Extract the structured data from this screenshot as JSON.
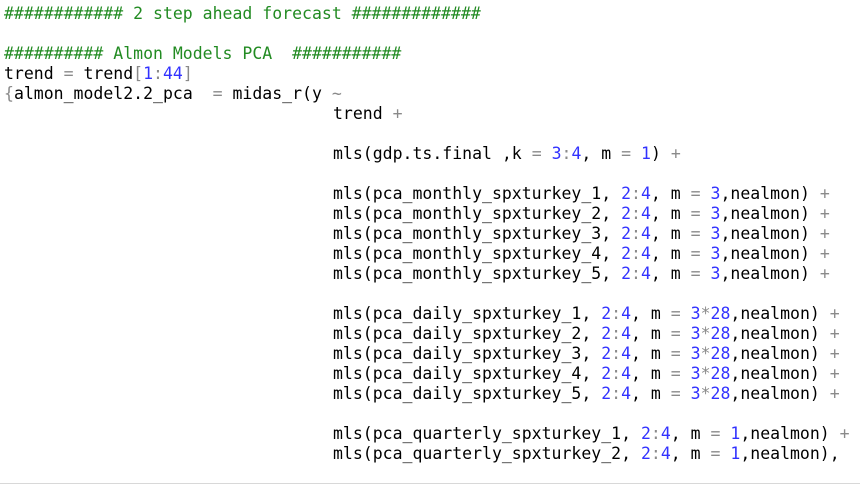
{
  "editor": {
    "colors": {
      "background": "#ffffff",
      "text": "#000000",
      "comment": "#228b22",
      "number": "#3232ff",
      "operator": "#8a8a8a"
    },
    "lines": [
      {
        "indent": 0,
        "tokens": [
          {
            "t": "############ 2 step ahead forecast #############",
            "c": "comment"
          }
        ]
      },
      {
        "indent": 0,
        "tokens": []
      },
      {
        "indent": 0,
        "tokens": [
          {
            "t": "########## Almon Models PCA  ###########",
            "c": "comment"
          }
        ]
      },
      {
        "indent": 0,
        "tokens": [
          {
            "t": "trend "
          },
          {
            "t": "=",
            "c": "op"
          },
          {
            "t": " trend"
          },
          {
            "t": "[",
            "c": "op"
          },
          {
            "t": "1",
            "c": "num"
          },
          {
            "t": ":",
            "c": "op"
          },
          {
            "t": "44",
            "c": "num"
          },
          {
            "t": "]",
            "c": "op"
          }
        ]
      },
      {
        "indent": 0,
        "tokens": [
          {
            "t": "{",
            "c": "op"
          },
          {
            "t": "almon_model2.2_pca  "
          },
          {
            "t": "=",
            "c": "op"
          },
          {
            "t": " midas_r(y "
          },
          {
            "t": "~",
            "c": "op"
          }
        ]
      },
      {
        "indent": 1,
        "tokens": [
          {
            "t": "trend "
          },
          {
            "t": "+",
            "c": "op"
          }
        ]
      },
      {
        "indent": 1,
        "tokens": []
      },
      {
        "indent": 1,
        "tokens": [
          {
            "t": "mls(gdp.ts.final ,k "
          },
          {
            "t": "=",
            "c": "op"
          },
          {
            "t": " "
          },
          {
            "t": "3",
            "c": "num"
          },
          {
            "t": ":",
            "c": "op"
          },
          {
            "t": "4",
            "c": "num"
          },
          {
            "t": ", m "
          },
          {
            "t": "=",
            "c": "op"
          },
          {
            "t": " "
          },
          {
            "t": "1",
            "c": "num"
          },
          {
            "t": ") "
          },
          {
            "t": "+",
            "c": "op"
          }
        ]
      },
      {
        "indent": 1,
        "tokens": []
      },
      {
        "indent": 1,
        "tokens": [
          {
            "t": "mls(pca_monthly_spxturkey_1, "
          },
          {
            "t": "2",
            "c": "num"
          },
          {
            "t": ":",
            "c": "op"
          },
          {
            "t": "4",
            "c": "num"
          },
          {
            "t": ", m "
          },
          {
            "t": "=",
            "c": "op"
          },
          {
            "t": " "
          },
          {
            "t": "3",
            "c": "num"
          },
          {
            "t": ",nealmon) "
          },
          {
            "t": "+",
            "c": "op"
          }
        ]
      },
      {
        "indent": 1,
        "tokens": [
          {
            "t": "mls(pca_monthly_spxturkey_2, "
          },
          {
            "t": "2",
            "c": "num"
          },
          {
            "t": ":",
            "c": "op"
          },
          {
            "t": "4",
            "c": "num"
          },
          {
            "t": ", m "
          },
          {
            "t": "=",
            "c": "op"
          },
          {
            "t": " "
          },
          {
            "t": "3",
            "c": "num"
          },
          {
            "t": ",nealmon) "
          },
          {
            "t": "+",
            "c": "op"
          }
        ]
      },
      {
        "indent": 1,
        "tokens": [
          {
            "t": "mls(pca_monthly_spxturkey_3, "
          },
          {
            "t": "2",
            "c": "num"
          },
          {
            "t": ":",
            "c": "op"
          },
          {
            "t": "4",
            "c": "num"
          },
          {
            "t": ", m "
          },
          {
            "t": "=",
            "c": "op"
          },
          {
            "t": " "
          },
          {
            "t": "3",
            "c": "num"
          },
          {
            "t": ",nealmon) "
          },
          {
            "t": "+",
            "c": "op"
          }
        ]
      },
      {
        "indent": 1,
        "tokens": [
          {
            "t": "mls(pca_monthly_spxturkey_4, "
          },
          {
            "t": "2",
            "c": "num"
          },
          {
            "t": ":",
            "c": "op"
          },
          {
            "t": "4",
            "c": "num"
          },
          {
            "t": ", m "
          },
          {
            "t": "=",
            "c": "op"
          },
          {
            "t": " "
          },
          {
            "t": "3",
            "c": "num"
          },
          {
            "t": ",nealmon) "
          },
          {
            "t": "+",
            "c": "op"
          }
        ]
      },
      {
        "indent": 1,
        "tokens": [
          {
            "t": "mls(pca_monthly_spxturkey_5, "
          },
          {
            "t": "2",
            "c": "num"
          },
          {
            "t": ":",
            "c": "op"
          },
          {
            "t": "4",
            "c": "num"
          },
          {
            "t": ", m "
          },
          {
            "t": "=",
            "c": "op"
          },
          {
            "t": " "
          },
          {
            "t": "3",
            "c": "num"
          },
          {
            "t": ",nealmon) "
          },
          {
            "t": "+",
            "c": "op"
          }
        ]
      },
      {
        "indent": 1,
        "tokens": []
      },
      {
        "indent": 1,
        "tokens": [
          {
            "t": "mls(pca_daily_spxturkey_1, "
          },
          {
            "t": "2",
            "c": "num"
          },
          {
            "t": ":",
            "c": "op"
          },
          {
            "t": "4",
            "c": "num"
          },
          {
            "t": ", m "
          },
          {
            "t": "=",
            "c": "op"
          },
          {
            "t": " "
          },
          {
            "t": "3",
            "c": "num"
          },
          {
            "t": "*",
            "c": "op"
          },
          {
            "t": "28",
            "c": "num"
          },
          {
            "t": ",nealmon) "
          },
          {
            "t": "+",
            "c": "op"
          }
        ]
      },
      {
        "indent": 1,
        "tokens": [
          {
            "t": "mls(pca_daily_spxturkey_2, "
          },
          {
            "t": "2",
            "c": "num"
          },
          {
            "t": ":",
            "c": "op"
          },
          {
            "t": "4",
            "c": "num"
          },
          {
            "t": ", m "
          },
          {
            "t": "=",
            "c": "op"
          },
          {
            "t": " "
          },
          {
            "t": "3",
            "c": "num"
          },
          {
            "t": "*",
            "c": "op"
          },
          {
            "t": "28",
            "c": "num"
          },
          {
            "t": ",nealmon) "
          },
          {
            "t": "+",
            "c": "op"
          }
        ]
      },
      {
        "indent": 1,
        "tokens": [
          {
            "t": "mls(pca_daily_spxturkey_3, "
          },
          {
            "t": "2",
            "c": "num"
          },
          {
            "t": ":",
            "c": "op"
          },
          {
            "t": "4",
            "c": "num"
          },
          {
            "t": ", m "
          },
          {
            "t": "=",
            "c": "op"
          },
          {
            "t": " "
          },
          {
            "t": "3",
            "c": "num"
          },
          {
            "t": "*",
            "c": "op"
          },
          {
            "t": "28",
            "c": "num"
          },
          {
            "t": ",nealmon) "
          },
          {
            "t": "+",
            "c": "op"
          }
        ]
      },
      {
        "indent": 1,
        "tokens": [
          {
            "t": "mls(pca_daily_spxturkey_4, "
          },
          {
            "t": "2",
            "c": "num"
          },
          {
            "t": ":",
            "c": "op"
          },
          {
            "t": "4",
            "c": "num"
          },
          {
            "t": ", m "
          },
          {
            "t": "=",
            "c": "op"
          },
          {
            "t": " "
          },
          {
            "t": "3",
            "c": "num"
          },
          {
            "t": "*",
            "c": "op"
          },
          {
            "t": "28",
            "c": "num"
          },
          {
            "t": ",nealmon) "
          },
          {
            "t": "+",
            "c": "op"
          }
        ]
      },
      {
        "indent": 1,
        "tokens": [
          {
            "t": "mls(pca_daily_spxturkey_5, "
          },
          {
            "t": "2",
            "c": "num"
          },
          {
            "t": ":",
            "c": "op"
          },
          {
            "t": "4",
            "c": "num"
          },
          {
            "t": ", m "
          },
          {
            "t": "=",
            "c": "op"
          },
          {
            "t": " "
          },
          {
            "t": "3",
            "c": "num"
          },
          {
            "t": "*",
            "c": "op"
          },
          {
            "t": "28",
            "c": "num"
          },
          {
            "t": ",nealmon) "
          },
          {
            "t": "+",
            "c": "op"
          }
        ]
      },
      {
        "indent": 1,
        "tokens": []
      },
      {
        "indent": 1,
        "tokens": [
          {
            "t": "mls(pca_quarterly_spxturkey_1, "
          },
          {
            "t": "2",
            "c": "num"
          },
          {
            "t": ":",
            "c": "op"
          },
          {
            "t": "4",
            "c": "num"
          },
          {
            "t": ", m "
          },
          {
            "t": "=",
            "c": "op"
          },
          {
            "t": " "
          },
          {
            "t": "1",
            "c": "num"
          },
          {
            "t": ",nealmon) "
          },
          {
            "t": "+",
            "c": "op"
          }
        ]
      },
      {
        "indent": 1,
        "tokens": [
          {
            "t": "mls(pca_quarterly_spxturkey_2, "
          },
          {
            "t": "2",
            "c": "num"
          },
          {
            "t": ":",
            "c": "op"
          },
          {
            "t": "4",
            "c": "num"
          },
          {
            "t": ", m "
          },
          {
            "t": "=",
            "c": "op"
          },
          {
            "t": " "
          },
          {
            "t": "1",
            "c": "num"
          },
          {
            "t": ",nealmon),"
          }
        ]
      }
    ]
  }
}
